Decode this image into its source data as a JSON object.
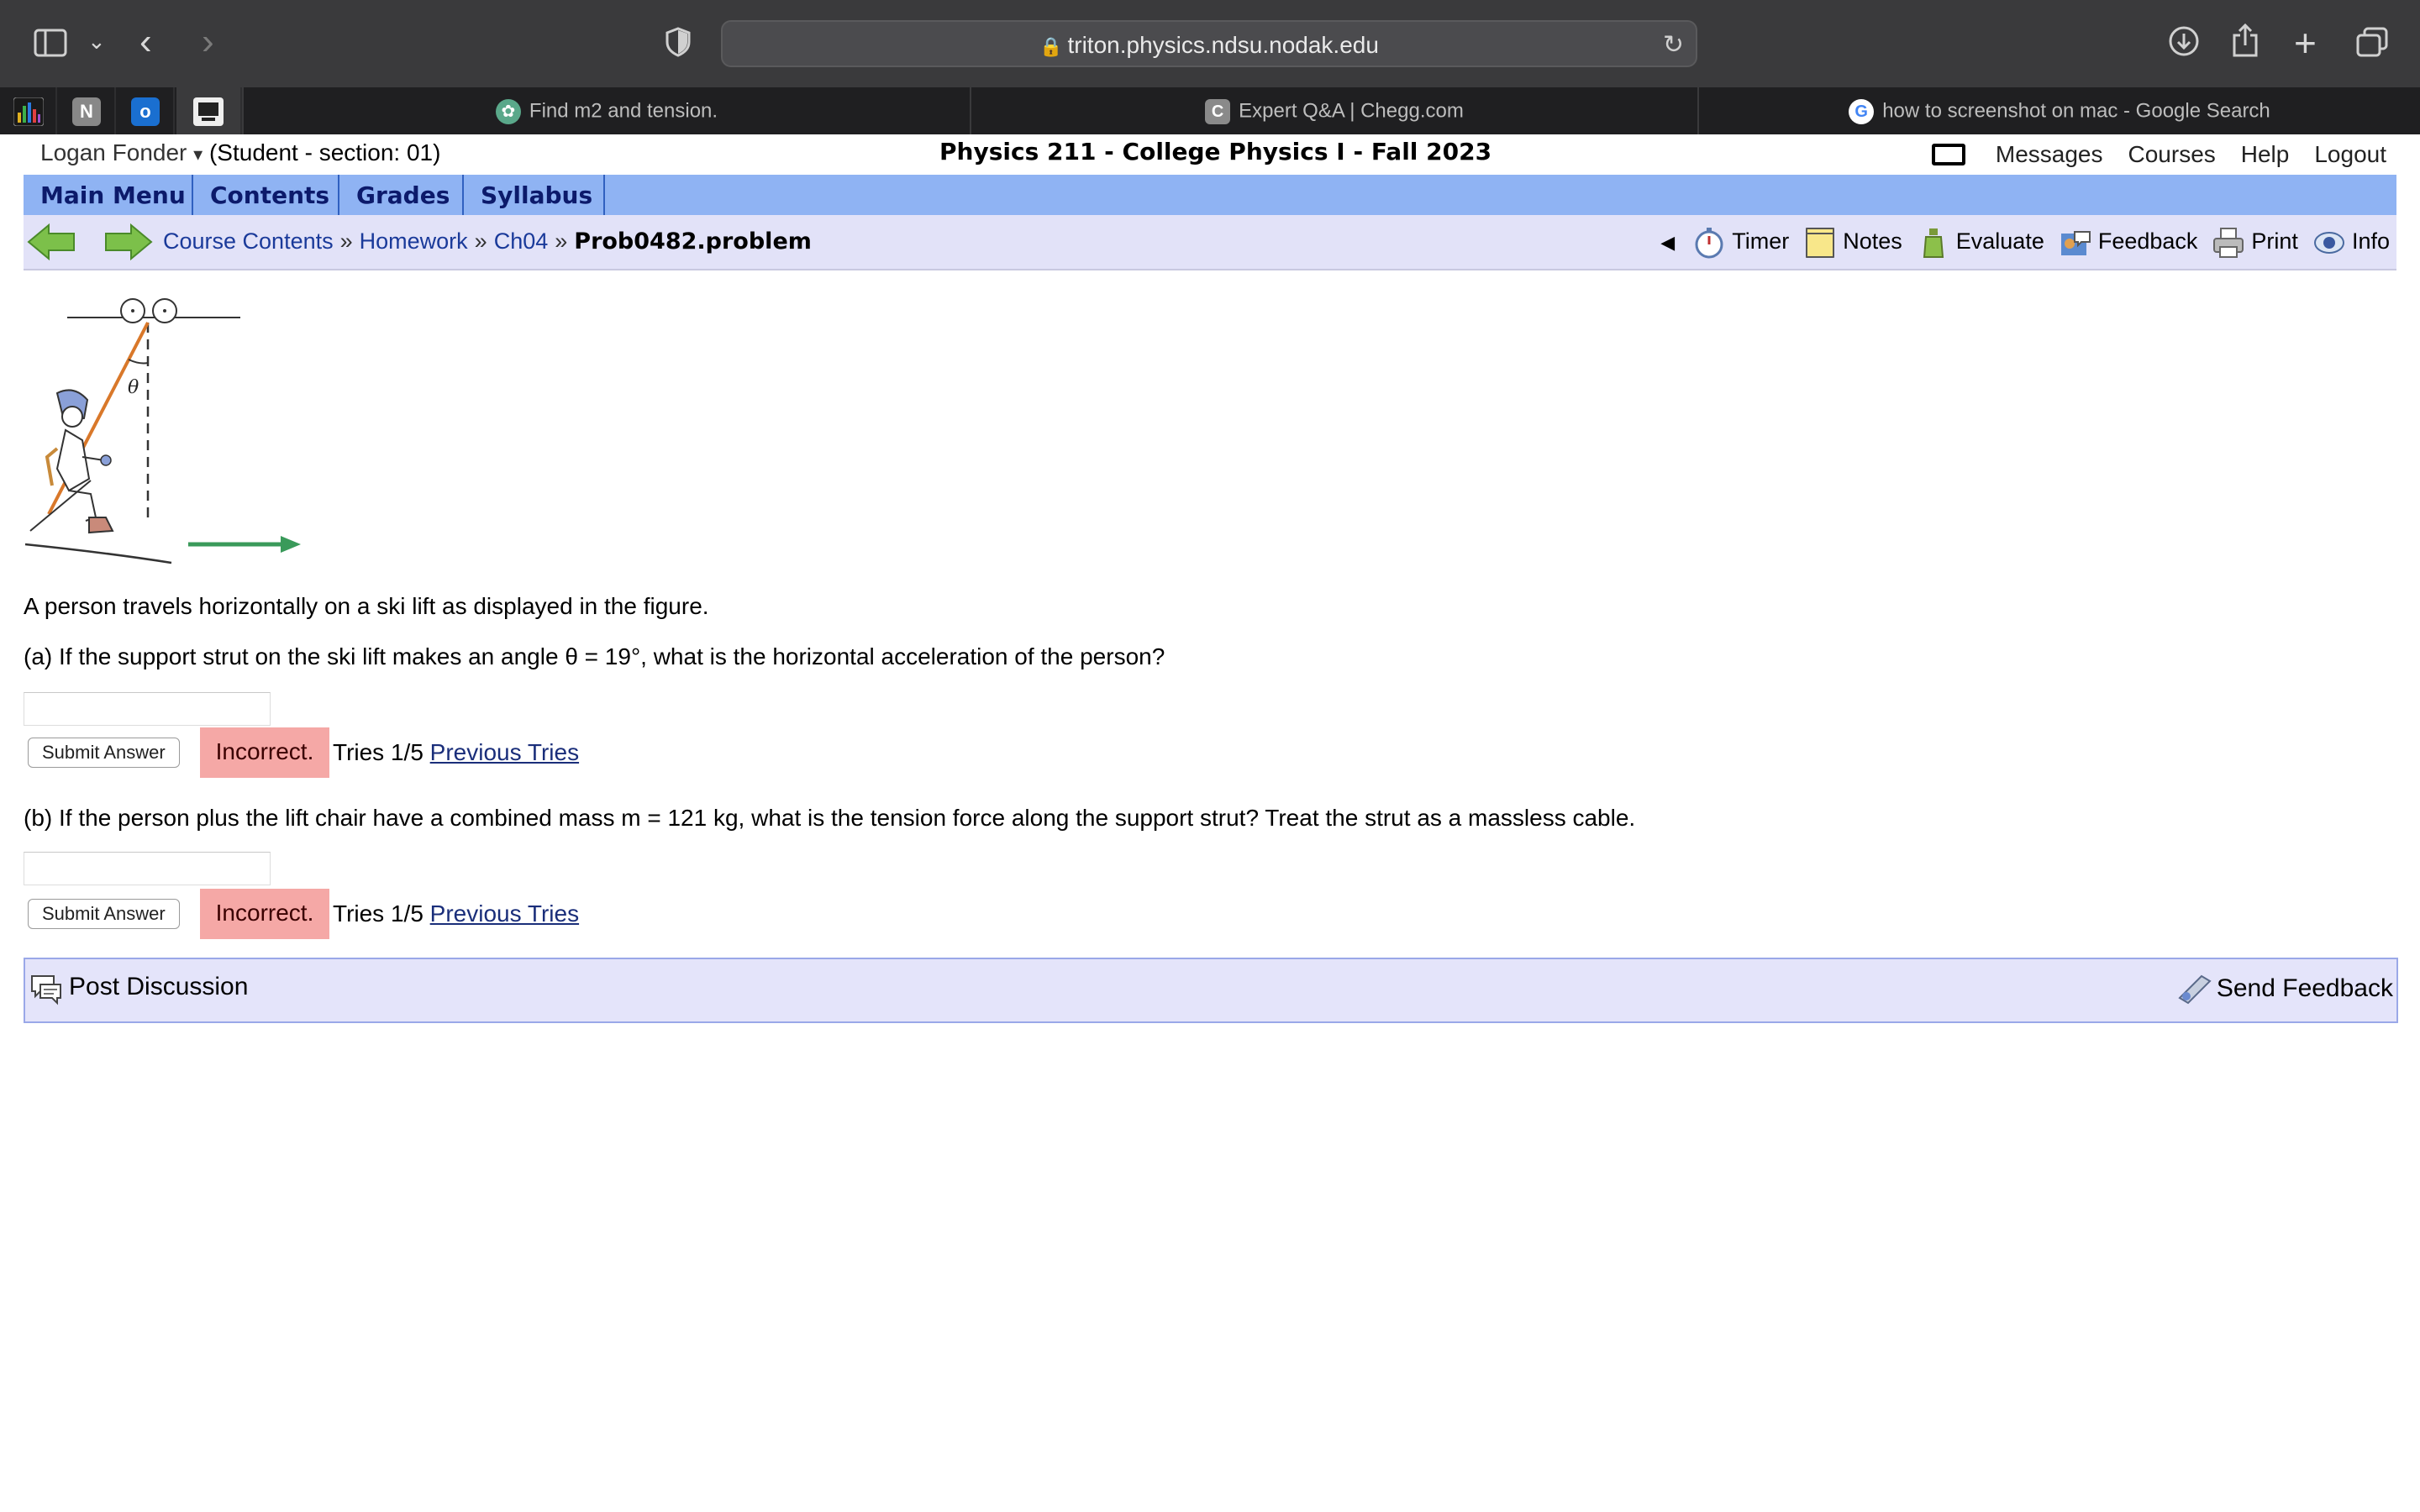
{
  "browser": {
    "url": "triton.physics.ndsu.nodak.edu",
    "pinned_tabs": [
      {
        "icon": "bar-chart-icon"
      },
      {
        "icon": "notion-icon",
        "glyph": "N"
      },
      {
        "icon": "outlook-icon",
        "glyph": "o"
      },
      {
        "icon": "lon-capa-icon"
      }
    ],
    "tabs": [
      {
        "label": "Find m2 and tension.",
        "icon": "chatgpt-icon"
      },
      {
        "label": "Expert Q&A | Chegg.com",
        "icon": "chegg-icon",
        "glyph": "C"
      },
      {
        "label": "how to screenshot on mac - Google Search",
        "icon": "google-icon",
        "glyph": "G"
      }
    ]
  },
  "header": {
    "user_name": "Logan Fonder",
    "user_caret": "▾",
    "user_role": "(Student  - section: 01)",
    "course_title": "Physics 211 - College Physics I - Fall 2023",
    "links": [
      "Messages",
      "Courses",
      "Help",
      "Logout"
    ]
  },
  "menu": [
    "Main Menu",
    "Contents",
    "Grades",
    "Syllabus"
  ],
  "breadcrumb": {
    "items": [
      "Course Contents",
      "Homework",
      "Ch04"
    ],
    "separator": "»",
    "current": "Prob0482.problem"
  },
  "tools": {
    "collapse": "◀",
    "items": [
      "Timer",
      "Notes",
      "Evaluate",
      "Feedback",
      "Print",
      "Info"
    ]
  },
  "figure": {
    "theta_label": "θ"
  },
  "problem": {
    "intro": "A person travels horizontally on a ski lift as displayed in the figure.",
    "part_a": "(a) If the support strut on the ski lift makes an angle θ = 19°, what is the horizontal acceleration of the person?",
    "part_b": "(b) If the person plus the lift chair have a combined mass m = 121 kg, what is the tension force along the support strut? Treat the strut as a massless cable.",
    "submit_label": "Submit Answer",
    "status": "Incorrect.",
    "tries": "Tries 1/5",
    "previous_tries": "Previous Tries",
    "answer_a_value": "",
    "answer_b_value": ""
  },
  "footer": {
    "post_discussion": "Post Discussion",
    "send_feedback": "Send Feedback"
  },
  "colors": {
    "menu_bg": "#8fb3f3",
    "nav_bg": "#e2e2f8",
    "incorrect_bg": "#f5a8a6",
    "link": "#1a3a9a"
  }
}
